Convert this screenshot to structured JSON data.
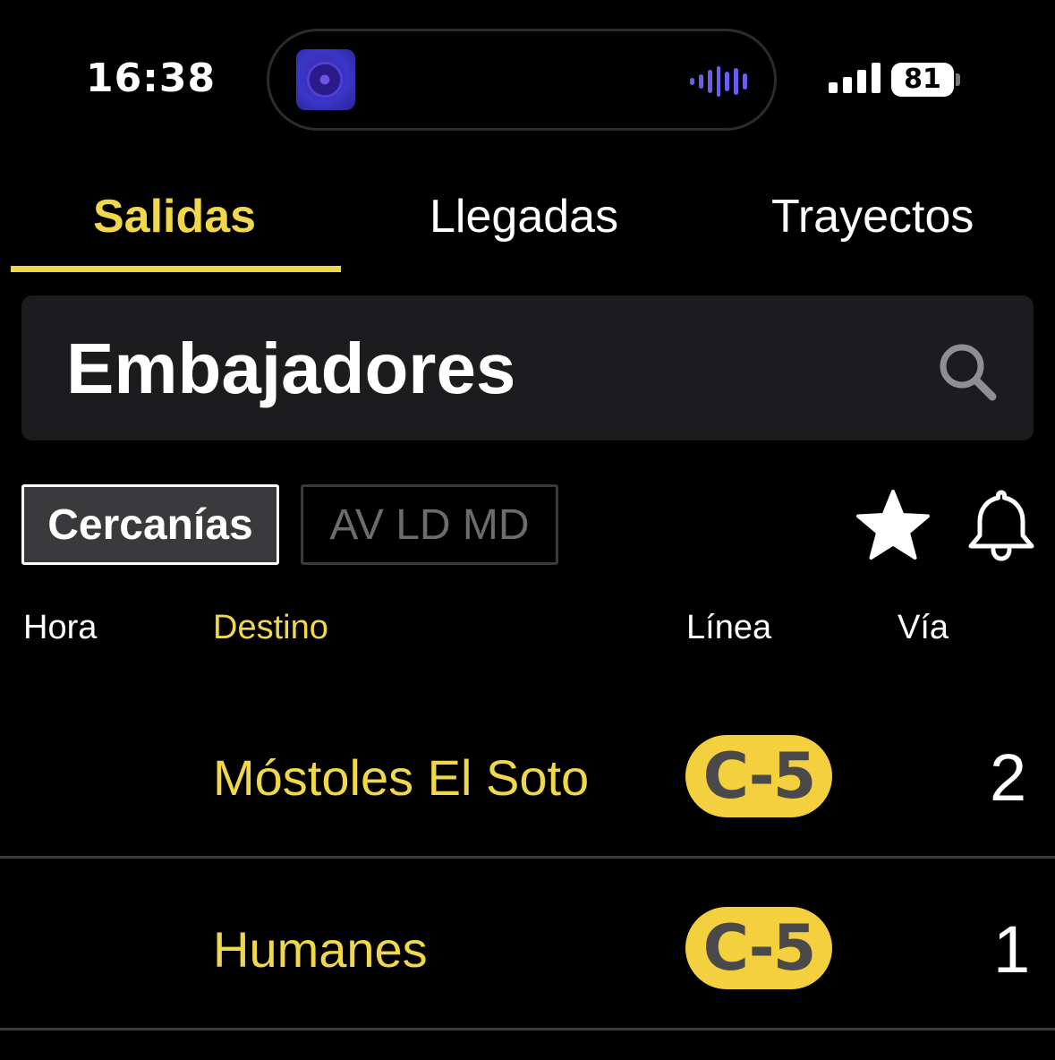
{
  "status_bar": {
    "time": "16:38",
    "battery": "81",
    "icons": [
      "album-art-icon",
      "audio-waveform-icon",
      "signal-icon",
      "battery-icon"
    ]
  },
  "tabs": [
    {
      "label": "Salidas",
      "active": true
    },
    {
      "label": "Llegadas",
      "active": false
    },
    {
      "label": "Trayectos",
      "active": false
    }
  ],
  "search": {
    "value": "Embajadores",
    "icon": "search-icon"
  },
  "filters": [
    {
      "label": "Cercanías",
      "selected": true
    },
    {
      "label": "AV LD MD",
      "selected": false
    }
  ],
  "actions": {
    "favorite_icon": "star-icon",
    "notify_icon": "bell-icon"
  },
  "table": {
    "headers": {
      "hora": "Hora",
      "destino": "Destino",
      "linea": "Línea",
      "via": "Vía"
    },
    "rows": [
      {
        "hora": "",
        "destino": "Móstoles El Soto",
        "linea": "C-5",
        "via": "2"
      },
      {
        "hora": "",
        "destino": "Humanes",
        "linea": "C-5",
        "via": "1"
      }
    ]
  },
  "colors": {
    "accent": "#f0d84a",
    "badge": "#f4cf3e",
    "background": "#000000",
    "search_bg": "#1c1c1e"
  }
}
